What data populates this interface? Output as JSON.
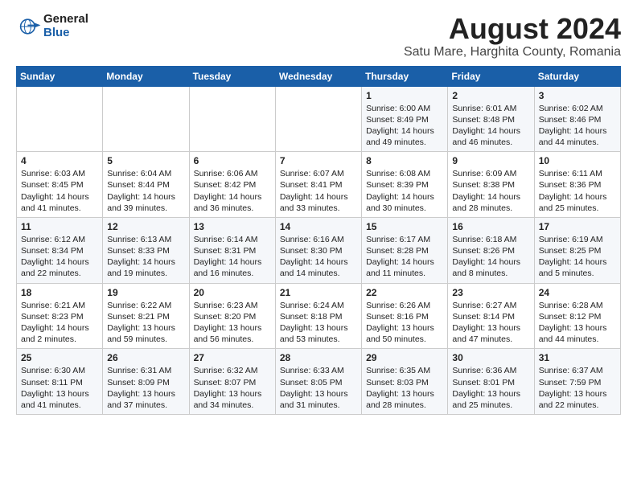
{
  "header": {
    "logo_general": "General",
    "logo_blue": "Blue",
    "title": "August 2024",
    "subtitle": "Satu Mare, Harghita County, Romania"
  },
  "calendar": {
    "days_of_week": [
      "Sunday",
      "Monday",
      "Tuesday",
      "Wednesday",
      "Thursday",
      "Friday",
      "Saturday"
    ],
    "weeks": [
      [
        {
          "day": "",
          "info": ""
        },
        {
          "day": "",
          "info": ""
        },
        {
          "day": "",
          "info": ""
        },
        {
          "day": "",
          "info": ""
        },
        {
          "day": "1",
          "info": "Sunrise: 6:00 AM\nSunset: 8:49 PM\nDaylight: 14 hours and 49 minutes."
        },
        {
          "day": "2",
          "info": "Sunrise: 6:01 AM\nSunset: 8:48 PM\nDaylight: 14 hours and 46 minutes."
        },
        {
          "day": "3",
          "info": "Sunrise: 6:02 AM\nSunset: 8:46 PM\nDaylight: 14 hours and 44 minutes."
        }
      ],
      [
        {
          "day": "4",
          "info": "Sunrise: 6:03 AM\nSunset: 8:45 PM\nDaylight: 14 hours and 41 minutes."
        },
        {
          "day": "5",
          "info": "Sunrise: 6:04 AM\nSunset: 8:44 PM\nDaylight: 14 hours and 39 minutes."
        },
        {
          "day": "6",
          "info": "Sunrise: 6:06 AM\nSunset: 8:42 PM\nDaylight: 14 hours and 36 minutes."
        },
        {
          "day": "7",
          "info": "Sunrise: 6:07 AM\nSunset: 8:41 PM\nDaylight: 14 hours and 33 minutes."
        },
        {
          "day": "8",
          "info": "Sunrise: 6:08 AM\nSunset: 8:39 PM\nDaylight: 14 hours and 30 minutes."
        },
        {
          "day": "9",
          "info": "Sunrise: 6:09 AM\nSunset: 8:38 PM\nDaylight: 14 hours and 28 minutes."
        },
        {
          "day": "10",
          "info": "Sunrise: 6:11 AM\nSunset: 8:36 PM\nDaylight: 14 hours and 25 minutes."
        }
      ],
      [
        {
          "day": "11",
          "info": "Sunrise: 6:12 AM\nSunset: 8:34 PM\nDaylight: 14 hours and 22 minutes."
        },
        {
          "day": "12",
          "info": "Sunrise: 6:13 AM\nSunset: 8:33 PM\nDaylight: 14 hours and 19 minutes."
        },
        {
          "day": "13",
          "info": "Sunrise: 6:14 AM\nSunset: 8:31 PM\nDaylight: 14 hours and 16 minutes."
        },
        {
          "day": "14",
          "info": "Sunrise: 6:16 AM\nSunset: 8:30 PM\nDaylight: 14 hours and 14 minutes."
        },
        {
          "day": "15",
          "info": "Sunrise: 6:17 AM\nSunset: 8:28 PM\nDaylight: 14 hours and 11 minutes."
        },
        {
          "day": "16",
          "info": "Sunrise: 6:18 AM\nSunset: 8:26 PM\nDaylight: 14 hours and 8 minutes."
        },
        {
          "day": "17",
          "info": "Sunrise: 6:19 AM\nSunset: 8:25 PM\nDaylight: 14 hours and 5 minutes."
        }
      ],
      [
        {
          "day": "18",
          "info": "Sunrise: 6:21 AM\nSunset: 8:23 PM\nDaylight: 14 hours and 2 minutes."
        },
        {
          "day": "19",
          "info": "Sunrise: 6:22 AM\nSunset: 8:21 PM\nDaylight: 13 hours and 59 minutes."
        },
        {
          "day": "20",
          "info": "Sunrise: 6:23 AM\nSunset: 8:20 PM\nDaylight: 13 hours and 56 minutes."
        },
        {
          "day": "21",
          "info": "Sunrise: 6:24 AM\nSunset: 8:18 PM\nDaylight: 13 hours and 53 minutes."
        },
        {
          "day": "22",
          "info": "Sunrise: 6:26 AM\nSunset: 8:16 PM\nDaylight: 13 hours and 50 minutes."
        },
        {
          "day": "23",
          "info": "Sunrise: 6:27 AM\nSunset: 8:14 PM\nDaylight: 13 hours and 47 minutes."
        },
        {
          "day": "24",
          "info": "Sunrise: 6:28 AM\nSunset: 8:12 PM\nDaylight: 13 hours and 44 minutes."
        }
      ],
      [
        {
          "day": "25",
          "info": "Sunrise: 6:30 AM\nSunset: 8:11 PM\nDaylight: 13 hours and 41 minutes."
        },
        {
          "day": "26",
          "info": "Sunrise: 6:31 AM\nSunset: 8:09 PM\nDaylight: 13 hours and 37 minutes."
        },
        {
          "day": "27",
          "info": "Sunrise: 6:32 AM\nSunset: 8:07 PM\nDaylight: 13 hours and 34 minutes."
        },
        {
          "day": "28",
          "info": "Sunrise: 6:33 AM\nSunset: 8:05 PM\nDaylight: 13 hours and 31 minutes."
        },
        {
          "day": "29",
          "info": "Sunrise: 6:35 AM\nSunset: 8:03 PM\nDaylight: 13 hours and 28 minutes."
        },
        {
          "day": "30",
          "info": "Sunrise: 6:36 AM\nSunset: 8:01 PM\nDaylight: 13 hours and 25 minutes."
        },
        {
          "day": "31",
          "info": "Sunrise: 6:37 AM\nSunset: 7:59 PM\nDaylight: 13 hours and 22 minutes."
        }
      ]
    ]
  }
}
